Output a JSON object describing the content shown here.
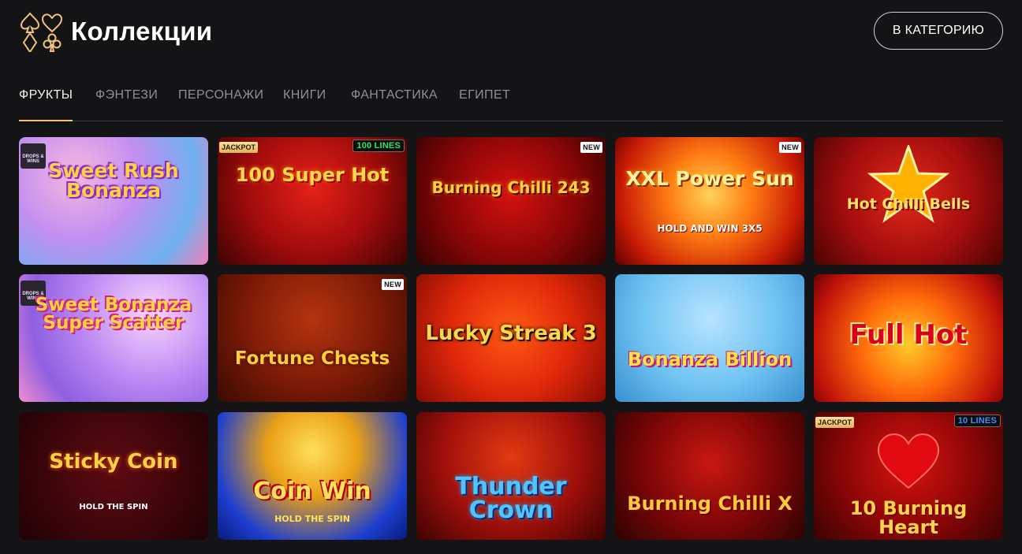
{
  "header": {
    "title": "Коллекции",
    "category_button": "В КАТЕГОРИЮ",
    "logo_icon": "card-suits-icon"
  },
  "tabs": [
    {
      "label": "ФРУКТЫ",
      "active": true
    },
    {
      "label": "ФЭНТЕЗИ",
      "active": false
    },
    {
      "label": "ПЕРСОНАЖИ",
      "active": false
    },
    {
      "label": "КНИГИ",
      "active": false
    },
    {
      "label": "ФАНТАСТИКА",
      "active": false
    },
    {
      "label": "ЕГИПЕТ",
      "active": false
    }
  ],
  "accent_color": "#f0c27a",
  "games": [
    {
      "title": "Sweet Rush Bonanza",
      "badge": "DROPS & WINS"
    },
    {
      "title": "100 Super Hot",
      "badge": "JACKPOT",
      "lines": "100 LINES"
    },
    {
      "title": "Burning Chilli 243",
      "badge": "NEW"
    },
    {
      "title": "XXL Power Sun",
      "subtitle": "HOLD AND WIN 3X5",
      "badge": "NEW"
    },
    {
      "title": "Hot Chilli Bells"
    },
    {
      "title": "Sweet Bonanza Super Scatter",
      "badge": "DROPS & WINS"
    },
    {
      "title": "Fortune Chests",
      "badge": "NEW"
    },
    {
      "title": "Lucky Streak 3"
    },
    {
      "title": "Bonanza Billion"
    },
    {
      "title": "Full Hot"
    },
    {
      "title": "Sticky Coin",
      "subtitle": "HOLD THE SPIN"
    },
    {
      "title": "Coin Win",
      "subtitle": "HOLD THE SPIN"
    },
    {
      "title": "Thunder Crown"
    },
    {
      "title": "Burning Chilli X"
    },
    {
      "title": "10 Burning Heart",
      "badge": "JACKPOT",
      "lines": "10 LINES"
    }
  ]
}
